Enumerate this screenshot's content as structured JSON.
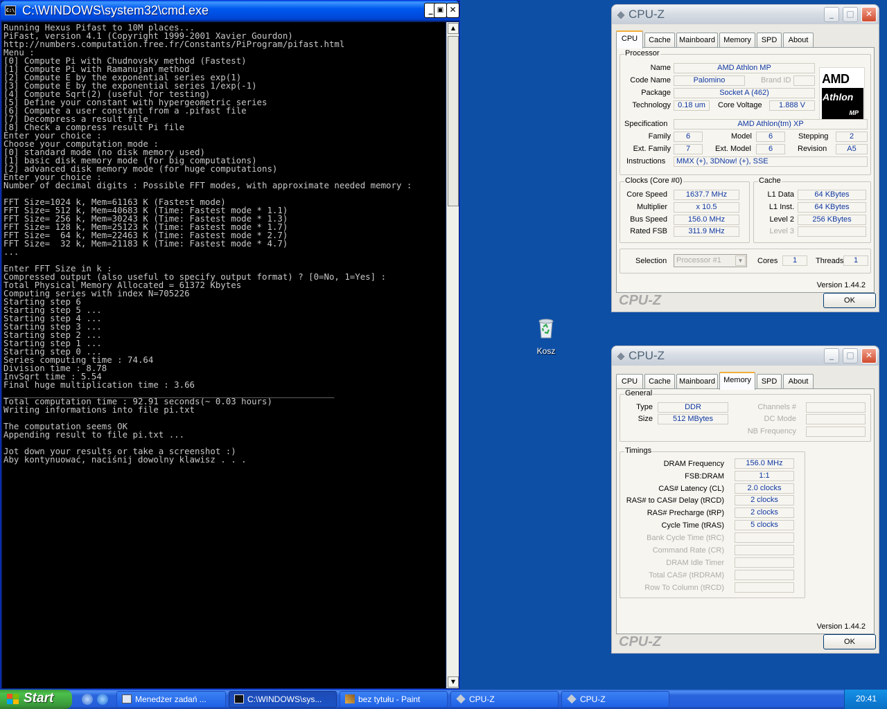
{
  "cmd": {
    "title": "C:\\WINDOWS\\system32\\cmd.exe",
    "icon_label": "C:\\",
    "lines": [
      "Running Hexus Pifast to 10M places...",
      "PiFast, version 4.1 (Copyright 1999-2001 Xavier Gourdon)",
      "http://numbers.computation.free.fr/Constants/PiProgram/pifast.html",
      "Menu :",
      "[0] Compute Pi with Chudnovsky method (Fastest)",
      "[1] Compute Pi with Ramanujan method",
      "[2] Compute E by the exponential series exp(1)",
      "[3] Compute E by the exponential series 1/exp(-1)",
      "[4] Compute Sqrt(2) (useful for testing)",
      "[5] Define your constant with hypergeometric series",
      "[6] Compute a user constant from a .pifast file",
      "[7] Decompress a result file",
      "[8] Check a compress result Pi file",
      "Enter your choice :",
      "Choose your computation mode :",
      "[0] standard mode (no disk memory used)",
      "[1] basic disk memory mode (for big computations)",
      "[2] advanced disk memory mode (for huge computations)",
      "Enter your choice :",
      "Number of decimal digits : Possible FFT modes, with approximate needed memory :",
      "",
      "FFT Size=1024 k, Mem=61163 K (Fastest mode)",
      "FFT Size= 512 k, Mem=40683 K (Time: Fastest mode * 1.1)",
      "FFT Size= 256 k, Mem=30243 K (Time: Fastest mode * 1.3)",
      "FFT Size= 128 k, Mem=25123 K (Time: Fastest mode * 1.7)",
      "FFT Size=  64 k, Mem=22463 K (Time: Fastest mode * 2.7)",
      "FFT Size=  32 k, Mem=21183 K (Time: Fastest mode * 4.7)",
      "...",
      "",
      "Enter FFT Size in k :",
      "Compressed output (also useful to specify output format) ? [0=No, 1=Yes] :",
      "Total Physical Memory Allocated = 61372 Kbytes",
      "Computing series with index N=705226",
      "Starting step 6",
      "Starting step 5 ...",
      "Starting step 4 ...",
      "Starting step 3 ...",
      "Starting step 2 ...",
      "Starting step 1 ...",
      "Starting step 0 ...",
      "Series computing time : 74.64",
      "Division time : 8.78",
      "InvSqrt time : 5.54",
      "Final huge multiplication time : 3.66",
      "________________________________________________________________",
      "Total computation time : 92.91 seconds(~ 0.03 hours)",
      "Writing informations into file pi.txt",
      "",
      "The computation seems OK",
      "Appending result to file pi.txt ...",
      "",
      "Jot down your results or take a screenshot :)",
      "Aby kontynuować, naciśnij dowolny klawisz . . ."
    ],
    "buttons": {
      "minimize": "_",
      "maximize": "▣",
      "close": "✕"
    },
    "scroll_up": "▲",
    "scroll_down": "▼"
  },
  "desktop": {
    "recycle_bin_label": "Kosz"
  },
  "cpuz_window1": {
    "title": "CPU-Z",
    "tabs": [
      "CPU",
      "Cache",
      "Mainboard",
      "Memory",
      "SPD",
      "About"
    ],
    "active_tab": "CPU",
    "processor": {
      "group_label": "Processor",
      "name_label": "Name",
      "name": "AMD Athlon MP",
      "codename_label": "Code Name",
      "codename": "Palomino",
      "brandid_label": "Brand ID",
      "brandid": "",
      "package_label": "Package",
      "package": "Socket A (462)",
      "technology_label": "Technology",
      "technology": "0.18 um",
      "corevoltage_label": "Core Voltage",
      "corevoltage": "1.888 V",
      "spec_label": "Specification",
      "spec": "AMD Athlon(tm) XP",
      "family_label": "Family",
      "family": "6",
      "model_label": "Model",
      "model": "6",
      "stepping_label": "Stepping",
      "stepping": "2",
      "extfamily_label": "Ext. Family",
      "extfamily": "7",
      "extmodel_label": "Ext. Model",
      "extmodel": "6",
      "revision_label": "Revision",
      "revision": "A5",
      "instructions_label": "Instructions",
      "instructions": "MMX (+), 3DNow! (+), SSE",
      "logo_amd": "AMD",
      "logo_athlon": "Athlon",
      "logo_mp": "MP"
    },
    "clocks": {
      "group_label": "Clocks (Core #0)",
      "corespeed_label": "Core Speed",
      "corespeed": "1637.7 MHz",
      "multiplier_label": "Multiplier",
      "multiplier": "x 10.5",
      "busspeed_label": "Bus Speed",
      "busspeed": "156.0 MHz",
      "ratedfsb_label": "Rated FSB",
      "ratedfsb": "311.9 MHz"
    },
    "cache": {
      "group_label": "Cache",
      "l1data_label": "L1 Data",
      "l1data": "64 KBytes",
      "l1inst_label": "L1 Inst.",
      "l1inst": "64 KBytes",
      "level2_label": "Level 2",
      "level2": "256 KBytes",
      "level3_label": "Level 3",
      "level3": ""
    },
    "selection": {
      "selection_label": "Selection",
      "selection_value": "Processor #1",
      "cores_label": "Cores",
      "cores": "1",
      "threads_label": "Threads",
      "threads": "1"
    },
    "version": "Version 1.44.2",
    "brand": "CPU-Z",
    "ok": "OK"
  },
  "cpuz_window2": {
    "title": "CPU-Z",
    "tabs": [
      "CPU",
      "Cache",
      "Mainboard",
      "Memory",
      "SPD",
      "About"
    ],
    "active_tab": "Memory",
    "general": {
      "group_label": "General",
      "type_label": "Type",
      "type": "DDR",
      "size_label": "Size",
      "size": "512 MBytes",
      "channels_label": "Channels #",
      "channels": "",
      "dcmode_label": "DC Mode",
      "dcmode": "",
      "nbfreq_label": "NB Frequency",
      "nbfreq": ""
    },
    "timings": {
      "group_label": "Timings",
      "dramfreq_label": "DRAM Frequency",
      "dramfreq": "156.0 MHz",
      "fsbdram_label": "FSB:DRAM",
      "fsbdram": "1:1",
      "cas_label": "CAS# Latency (CL)",
      "cas": "2.0 clocks",
      "trcd_label": "RAS# to CAS# Delay (tRCD)",
      "trcd": "2 clocks",
      "trp_label": "RAS# Precharge (tRP)",
      "trp": "2 clocks",
      "tras_label": "Cycle Time (tRAS)",
      "tras": "5 clocks",
      "trc_label": "Bank Cycle Time (tRC)",
      "trc": "",
      "cr_label": "Command Rate (CR)",
      "cr": "",
      "idle_label": "DRAM Idle Timer",
      "idle": "",
      "trdram_label": "Total CAS# (tRDRAM)",
      "trdram": "",
      "rtc_label": "Row To Column (tRCD)",
      "rtc": ""
    },
    "version": "Version 1.44.2",
    "brand": "CPU-Z",
    "ok": "OK"
  },
  "taskbar": {
    "start": "Start",
    "tasks": [
      "Menedżer zadań ...",
      "C:\\WINDOWS\\sys...",
      "bez tytułu - Paint",
      "CPU-Z",
      "CPU-Z"
    ],
    "clock": "20:41"
  },
  "colors": {
    "value_text": "#0f37a0",
    "console_text": "#c8c8c8",
    "desktop": "#0e4fa6",
    "active_tab_accent": "#f1ae38"
  }
}
